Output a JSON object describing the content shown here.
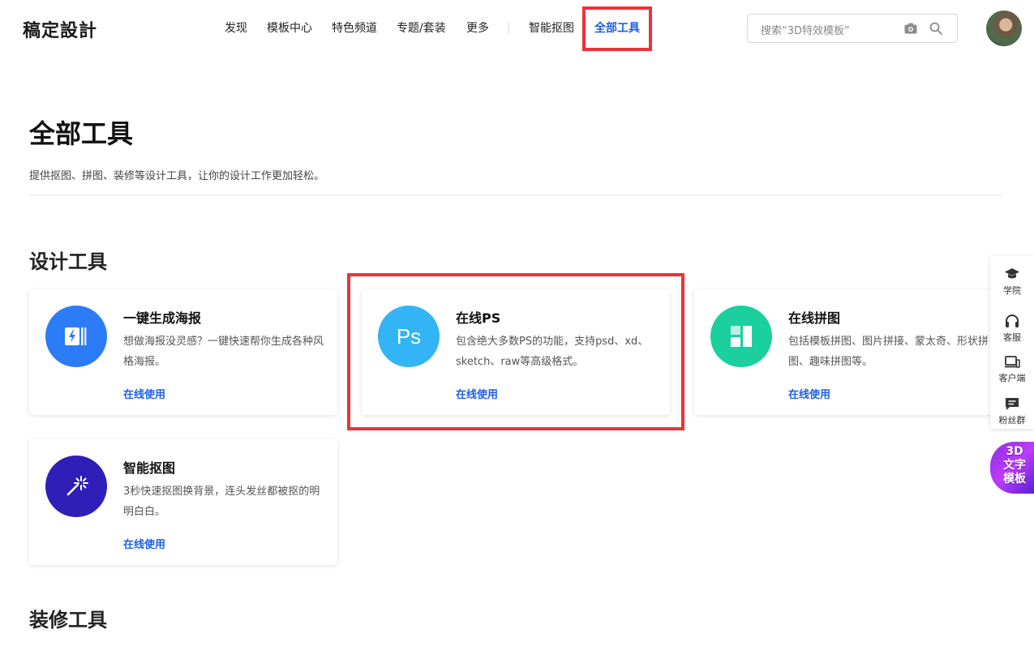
{
  "header": {
    "logo": "稿定設計",
    "nav": [
      {
        "label": "发现"
      },
      {
        "label": "模板中心"
      },
      {
        "label": "特色频道"
      },
      {
        "label": "专题/套装"
      },
      {
        "label": "更多"
      },
      {
        "label": "智能抠图"
      },
      {
        "label": "全部工具",
        "active": true
      }
    ],
    "search": {
      "placeholder": "搜索“3D特效模板”"
    }
  },
  "page": {
    "title": "全部工具",
    "description": "提供抠图、拼图、装修等设计工具，让你的设计工作更加轻松。"
  },
  "sections": [
    {
      "title": "设计工具"
    },
    {
      "title": "装修工具"
    }
  ],
  "tools": [
    {
      "title": "一键生成海报",
      "desc": "想做海报没灵感？一键快速帮你生成各种风格海报。",
      "link": "在线使用",
      "color": "#2b7cf6",
      "icon": "poster-bolt-icon"
    },
    {
      "title": "在线PS",
      "desc": "包含绝大多数PS的功能，支持psd、xd、sketch、raw等高级格式。",
      "link": "在线使用",
      "color": "#33b5f5",
      "icon_text": "Ps",
      "icon": "photoshop-icon"
    },
    {
      "title": "在线拼图",
      "desc": "包括模板拼图、图片拼接、蒙太奇、形状拼图、趣味拼图等。",
      "link": "在线使用",
      "color": "#1ccf9e",
      "icon": "collage-grid-icon"
    },
    {
      "title": "智能抠图",
      "desc": "3秒快速抠图换背景，连头发丝都被抠的明明白白。",
      "link": "在线使用",
      "color": "#2f1fb8",
      "icon": "magic-wand-icon"
    }
  ],
  "floatbar": [
    {
      "label": "学院",
      "icon": "graduation-cap-icon"
    },
    {
      "label": "客服",
      "icon": "headset-icon"
    },
    {
      "label": "客户端",
      "icon": "desktop-client-icon"
    },
    {
      "label": "粉丝群",
      "icon": "chat-bubble-icon"
    }
  ],
  "promo": {
    "text": "3D\n文字\n模板"
  },
  "colors": {
    "accent": "#1e5fe6",
    "highlight": "#ec3238"
  }
}
